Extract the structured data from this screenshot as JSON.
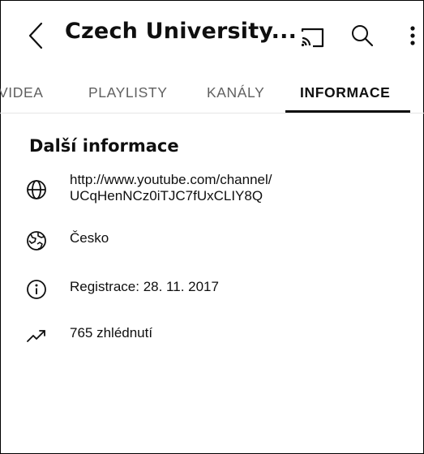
{
  "header": {
    "title": "Czech University...",
    "back_icon": "chevron-left-icon",
    "cast_icon": "cast-icon",
    "search_icon": "search-icon",
    "more_icon": "more-vertical-icon"
  },
  "tabs": [
    {
      "label": "VIDEA",
      "active": false
    },
    {
      "label": "PLAYLISTY",
      "active": false
    },
    {
      "label": "KANÁLY",
      "active": false
    },
    {
      "label": "INFORMACE",
      "active": true
    }
  ],
  "details": {
    "section_title": "Další informace",
    "link_line1": "http://www.youtube.com/channel/",
    "link_line2": "UCqHenNCz0iTJC7fUxCLIY8Q",
    "country": "Česko",
    "registration": "Registrace: 28. 11. 2017",
    "views": "765 zhlédnutí"
  },
  "colors": {
    "link": "#065fd4",
    "text": "#0f0f0f",
    "inactive_tab": "#606060"
  }
}
